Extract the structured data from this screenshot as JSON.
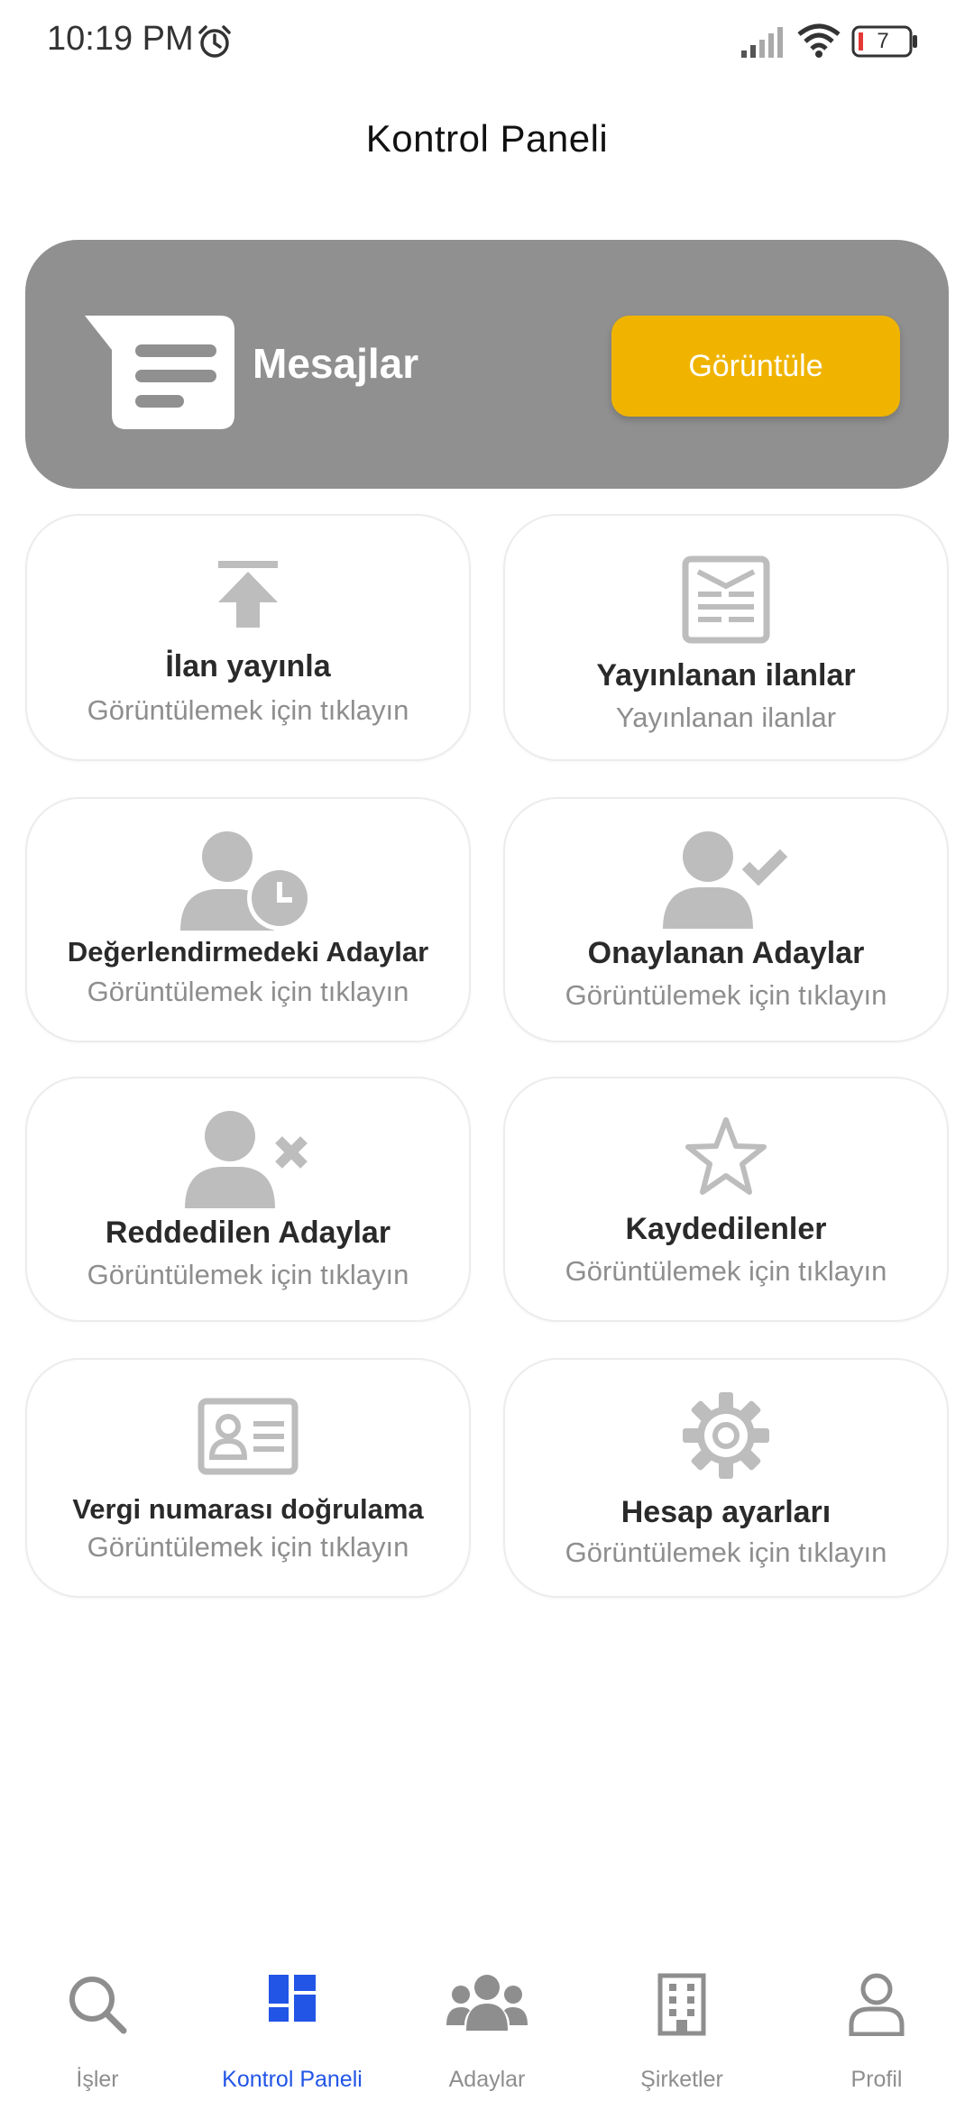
{
  "status_bar": {
    "time": "10:19 PM",
    "battery": "7"
  },
  "header": {
    "title": "Kontrol Paneli"
  },
  "messages": {
    "label": "Mesajlar",
    "button_label": "Görüntüle",
    "button_color": "#f0b400",
    "card_color": "#909090"
  },
  "tiles": [
    {
      "title": "İlan yayınla",
      "subtitle": "Görüntülemek için tıklayın",
      "icon": "upload-icon"
    },
    {
      "title": "Yayınlanan ilanlar",
      "subtitle": "Yayınlanan ilanlar",
      "icon": "newspaper-icon"
    },
    {
      "title": "Değerlendirmedeki Adaylar",
      "subtitle": "Görüntülemek için tıklayın",
      "icon": "user-clock-icon"
    },
    {
      "title": "Onaylanan Adaylar",
      "subtitle": "Görüntülemek için tıklayın",
      "icon": "user-check-icon"
    },
    {
      "title": "Reddedilen Adaylar",
      "subtitle": "Görüntülemek için tıklayın",
      "icon": "user-times-icon"
    },
    {
      "title": "Kaydedilenler",
      "subtitle": "Görüntülemek için tıklayın",
      "icon": "star-icon"
    },
    {
      "title": "Vergi numarası doğrulama",
      "subtitle": "Görüntülemek için tıklayın",
      "icon": "id-card-icon"
    },
    {
      "title": "Hesap ayarları",
      "subtitle": "Görüntülemek için tıklayın",
      "icon": "gear-icon"
    }
  ],
  "nav": {
    "items": [
      {
        "label": "İşler",
        "icon": "search-icon",
        "active": false
      },
      {
        "label": "Kontrol Paneli",
        "icon": "dashboard-icon",
        "active": true
      },
      {
        "label": "Adaylar",
        "icon": "users-icon",
        "active": false
      },
      {
        "label": "Şirketler",
        "icon": "building-icon",
        "active": false
      },
      {
        "label": "Profil",
        "icon": "person-icon",
        "active": false
      }
    ],
    "active_color": "#2255e6",
    "inactive_color": "#8e8e8e"
  }
}
